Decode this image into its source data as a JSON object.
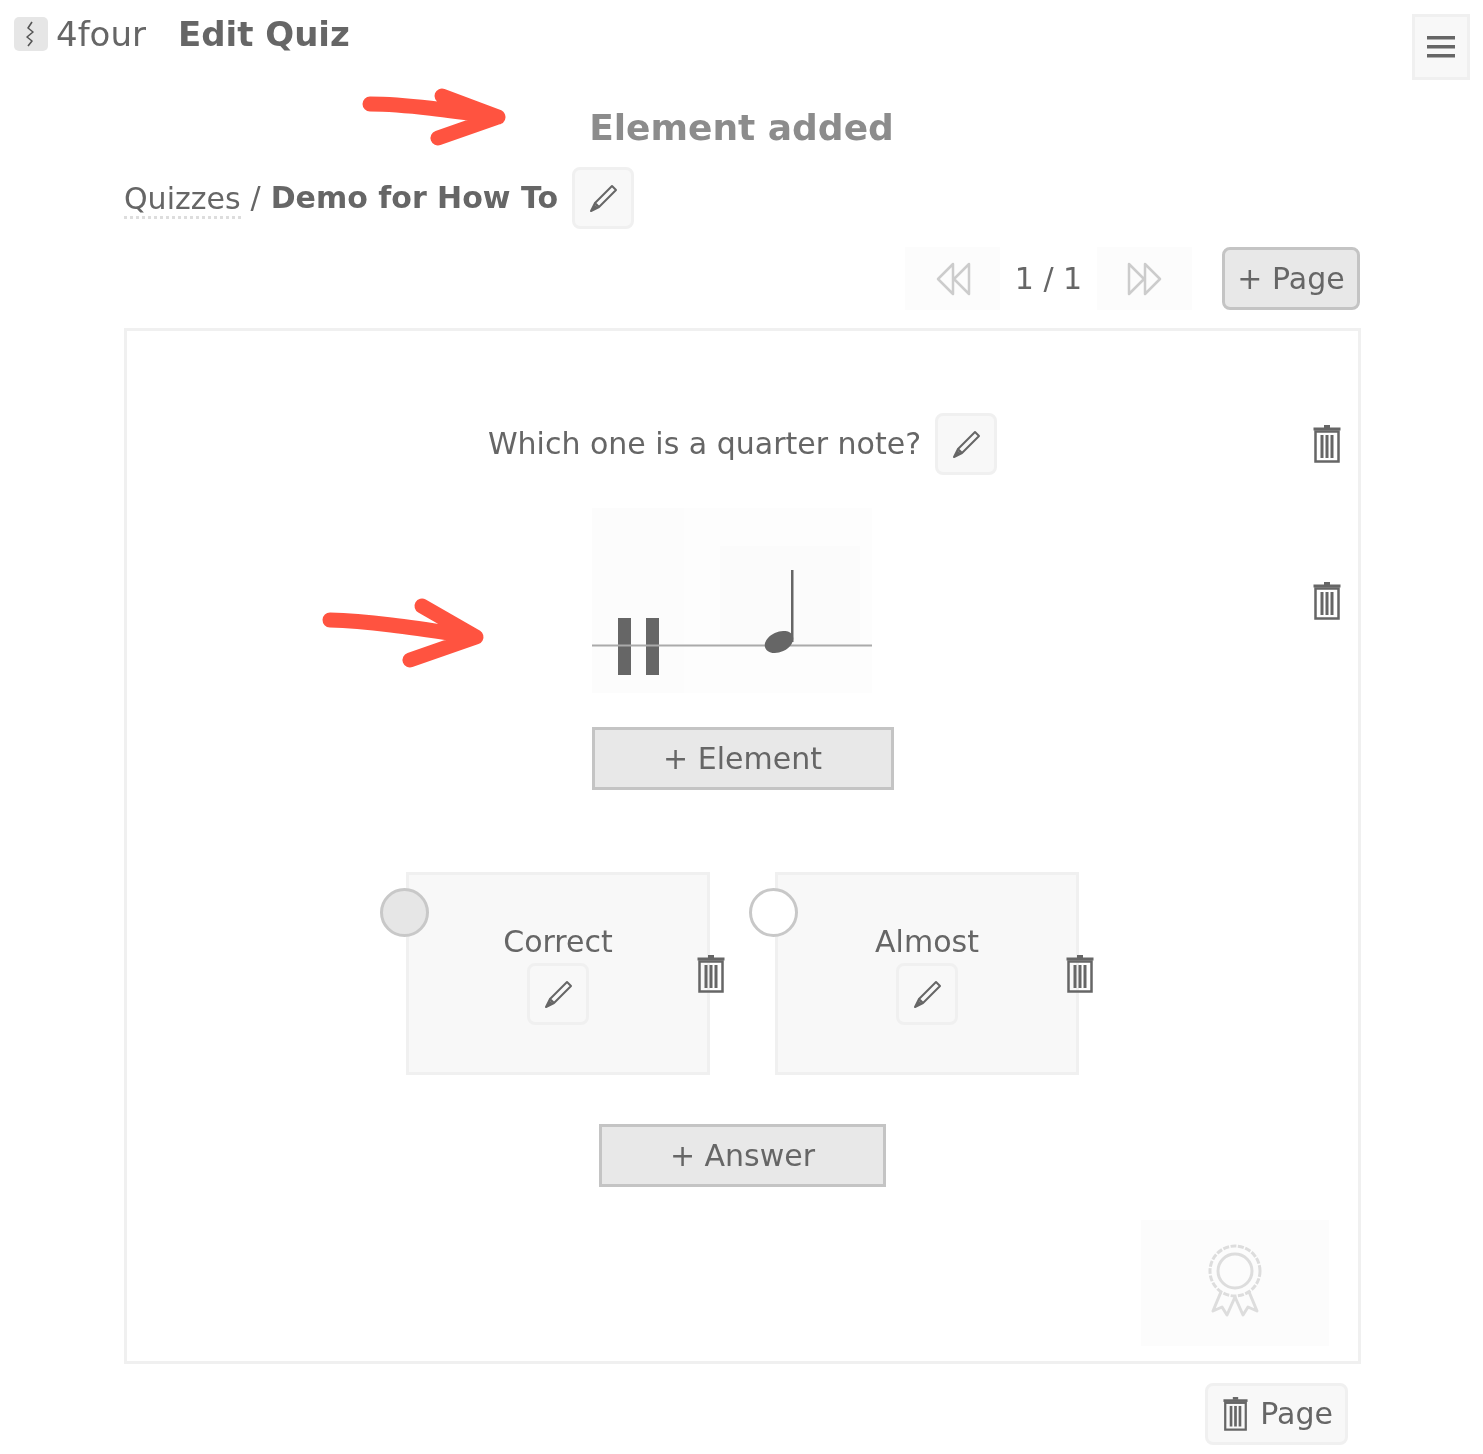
{
  "app": {
    "name": "4four",
    "title": "Edit Quiz"
  },
  "notification": "Element added",
  "breadcrumb": {
    "parent": "Quizzes",
    "separator": "/",
    "current": "Demo for How To"
  },
  "pager": {
    "previous": {
      "disabled": true
    },
    "indicator": "1 / 1",
    "next": {
      "disabled": true
    },
    "add_page": "+ Page"
  },
  "question": {
    "text": "Which one is a quarter note?"
  },
  "elements": [
    {
      "kind": "notation"
    }
  ],
  "add_element": "+ Element",
  "answers": [
    {
      "text": "Correct",
      "selected": true
    },
    {
      "text": "Almost",
      "selected": false
    }
  ],
  "add_answer": "+ Answer",
  "delete_page": "Page"
}
